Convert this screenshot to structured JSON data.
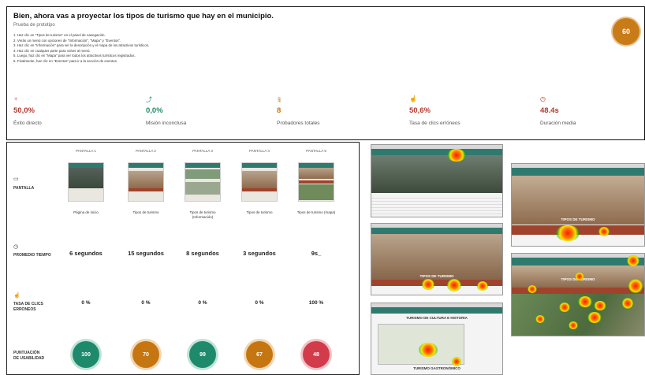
{
  "header": {
    "title": "Bien, ahora vas a proyectar los tipos de turismo que hay en el municipio.",
    "subtitle": "Prueba de prototipo",
    "steps": [
      "1. Haz clic en \"Tipos de turismo\" en el panel de navegación.",
      "2. Verás un menú con opciones de \"Información\", \"Mapa\" y \"Eventos\".",
      "3. Haz clic en \"Información\" para ver la descripción y el mapa de los atractivos turísticos.",
      "4. Haz clic en cualquier parte para volver al menú.",
      "5. Luego, haz clic en \"Mapa\" para ver todos los atractivos turísticos registrados.",
      "6. Finalmente, haz clic en \"Eventos\" para ir a la sección de eventos."
    ],
    "score": "60"
  },
  "metrics": [
    {
      "icon": "target-icon",
      "value": "50,0%",
      "label": "Éxito directo"
    },
    {
      "icon": "path-icon",
      "value": "0,0%",
      "label": "Misión inconclusa"
    },
    {
      "icon": "users-icon",
      "value": "8",
      "label": "Probadores totales"
    },
    {
      "icon": "click-icon",
      "value": "50,6%",
      "label": "Tasa de clics erróneos"
    },
    {
      "icon": "clock-icon",
      "value": "48.4s",
      "label": "Duración media"
    }
  ],
  "table": {
    "row_labels": {
      "screen": "PANTALLA",
      "time": "PROMEDIO TIEMPO",
      "errors": "TASA DE CLICS ERRONEOS",
      "usability": "PUNTUACIÓN DE USABILIDAD"
    },
    "columns": [
      {
        "header": "PANTALLA 1",
        "caption": "Página de inicio",
        "time": "6 segundos",
        "errors": "0 %",
        "usability": "100",
        "usability_color": "green"
      },
      {
        "header": "PANTALLA 2",
        "caption": "Tipos de turismo",
        "time": "15 segundos",
        "errors": "0 %",
        "usability": "70",
        "usability_color": "orange"
      },
      {
        "header": "PANTALLA 3",
        "caption": "Tipos de turismo (Información)",
        "time": "8 segundos",
        "errors": "0 %",
        "usability": "99",
        "usability_color": "green"
      },
      {
        "header": "PANTALLA 4",
        "caption": "Tipos de turismo",
        "time": "3 segundos",
        "errors": "0 %",
        "usability": "67",
        "usability_color": "orange"
      },
      {
        "header": "PANTALLA 5",
        "caption": "Tipos de turismo (mapa)",
        "time": "9s_",
        "errors": "100 %",
        "usability": "48",
        "usability_color": "red"
      }
    ]
  },
  "heatmaps": {
    "texts": {
      "tipos_1": "TIPOS DE TURISMO",
      "tipos_2": "TIPOS DE TURISMO",
      "tipos_3": "TIPOS DE TURISMO",
      "cultura": "TURISMO DE CULTURA E HISTORIA",
      "gastro": "TURISMO GASTRONÓMICO"
    }
  },
  "colors": {
    "accent_red": "#b03a2e",
    "accent_green": "#1f8a6b",
    "accent_orange": "#c67610",
    "nav_teal": "#2f7a6e"
  }
}
